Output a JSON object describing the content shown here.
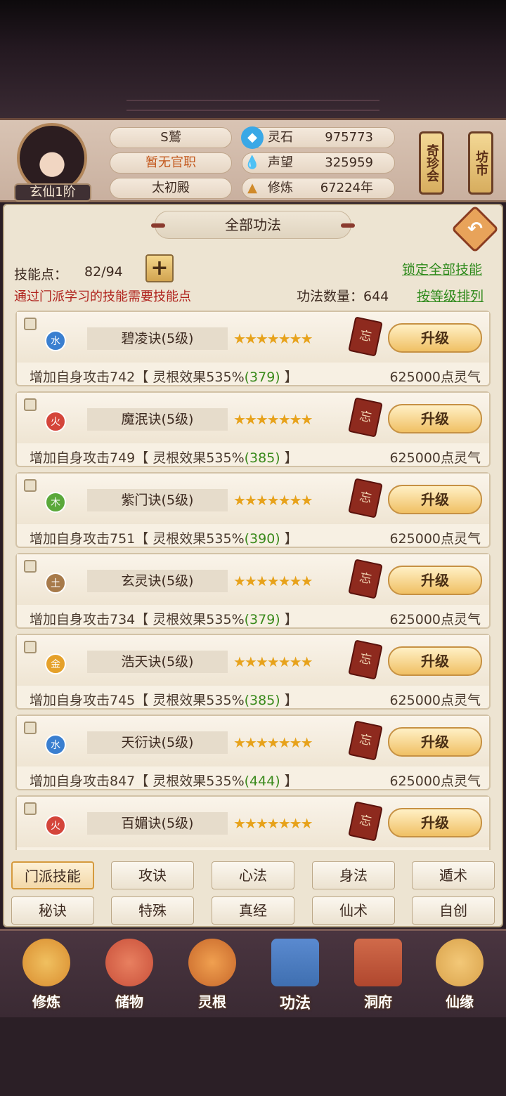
{
  "header": {
    "rank": "玄仙1阶",
    "name": "S鷲",
    "official_post": "暂无官职",
    "sect": "太初殿",
    "resources": [
      {
        "icon": "spirit-stone-icon",
        "label": "灵石",
        "value": "975773"
      },
      {
        "icon": "reputation-icon",
        "label": "声望",
        "value": "325959"
      },
      {
        "icon": "cultivation-icon",
        "label": "修炼",
        "value": "67224年"
      }
    ],
    "banners": [
      "奇珍会",
      "坊市"
    ]
  },
  "panel": {
    "title": "全部功法",
    "skill_points_label": "技能点：",
    "skill_points_value": "82/94",
    "plus": "+",
    "hint": "通过门派学习的技能需要技能点",
    "lock_all": "锁定全部技能",
    "count_label": "功法数量：644",
    "sort": "按等级排列",
    "back": "↶"
  },
  "skills": [
    {
      "element": "水",
      "color": "#3a7fd0",
      "name": "碧凌诀(5级)",
      "stars": "★★★★★★★",
      "forget": "忘",
      "upgrade": "升级",
      "desc": "增加自身攻击742【 灵根效果535%",
      "bonus": "(379)",
      "desc_end": " 】",
      "cost": "625000点灵气"
    },
    {
      "element": "火",
      "color": "#d4453a",
      "name": "魔泯诀(5级)",
      "stars": "★★★★★★★",
      "forget": "忘",
      "upgrade": "升级",
      "desc": "增加自身攻击749【 灵根效果535%",
      "bonus": "(385)",
      "desc_end": " 】",
      "cost": "625000点灵气"
    },
    {
      "element": "木",
      "color": "#5aa83a",
      "name": "紫门诀(5级)",
      "stars": "★★★★★★★",
      "forget": "忘",
      "upgrade": "升级",
      "desc": "增加自身攻击751【 灵根效果535%",
      "bonus": "(390)",
      "desc_end": " 】",
      "cost": "625000点灵气"
    },
    {
      "element": "土",
      "color": "#a77a4a",
      "name": "玄灵诀(5级)",
      "stars": "★★★★★★★",
      "forget": "忘",
      "upgrade": "升级",
      "desc": "增加自身攻击734【 灵根效果535%",
      "bonus": "(379)",
      "desc_end": " 】",
      "cost": "625000点灵气"
    },
    {
      "element": "金",
      "color": "#e5a12a",
      "name": "浩天诀(5级)",
      "stars": "★★★★★★★",
      "forget": "忘",
      "upgrade": "升级",
      "desc": "增加自身攻击745【 灵根效果535%",
      "bonus": "(385)",
      "desc_end": " 】",
      "cost": "625000点灵气"
    },
    {
      "element": "水",
      "color": "#3a7fd0",
      "name": "天衍诀(5级)",
      "stars": "★★★★★★★",
      "forget": "忘",
      "upgrade": "升级",
      "desc": "增加自身攻击847【 灵根效果535%",
      "bonus": "(444)",
      "desc_end": " 】",
      "cost": "625000点灵气"
    },
    {
      "element": "火",
      "color": "#d4453a",
      "name": "百媚诀(5级)",
      "stars": "★★★★★★★",
      "forget": "忘",
      "upgrade": "升级",
      "desc": "",
      "bonus": "",
      "desc_end": "",
      "cost": ""
    }
  ],
  "tabs_row1": [
    "门派技能",
    "攻诀",
    "心法",
    "身法",
    "遁术"
  ],
  "tabs_row2": [
    "秘诀",
    "特殊",
    "真经",
    "仙术",
    "自创"
  ],
  "active_tab": "门派技能",
  "nav": [
    {
      "label": "修炼",
      "icon": "cultivate-icon",
      "color": "#d98c2e"
    },
    {
      "label": "储物",
      "icon": "storage-bag-icon",
      "color": "#c9503a"
    },
    {
      "label": "灵根",
      "icon": "spirit-root-icon",
      "color": "#c7672a"
    },
    {
      "label": "功法",
      "icon": "skill-book-icon",
      "color": "#3f6fb0"
    },
    {
      "label": "洞府",
      "icon": "cave-house-icon",
      "color": "#b0472e"
    },
    {
      "label": "仙缘",
      "icon": "gourd-icon",
      "color": "#d9a24a"
    }
  ]
}
